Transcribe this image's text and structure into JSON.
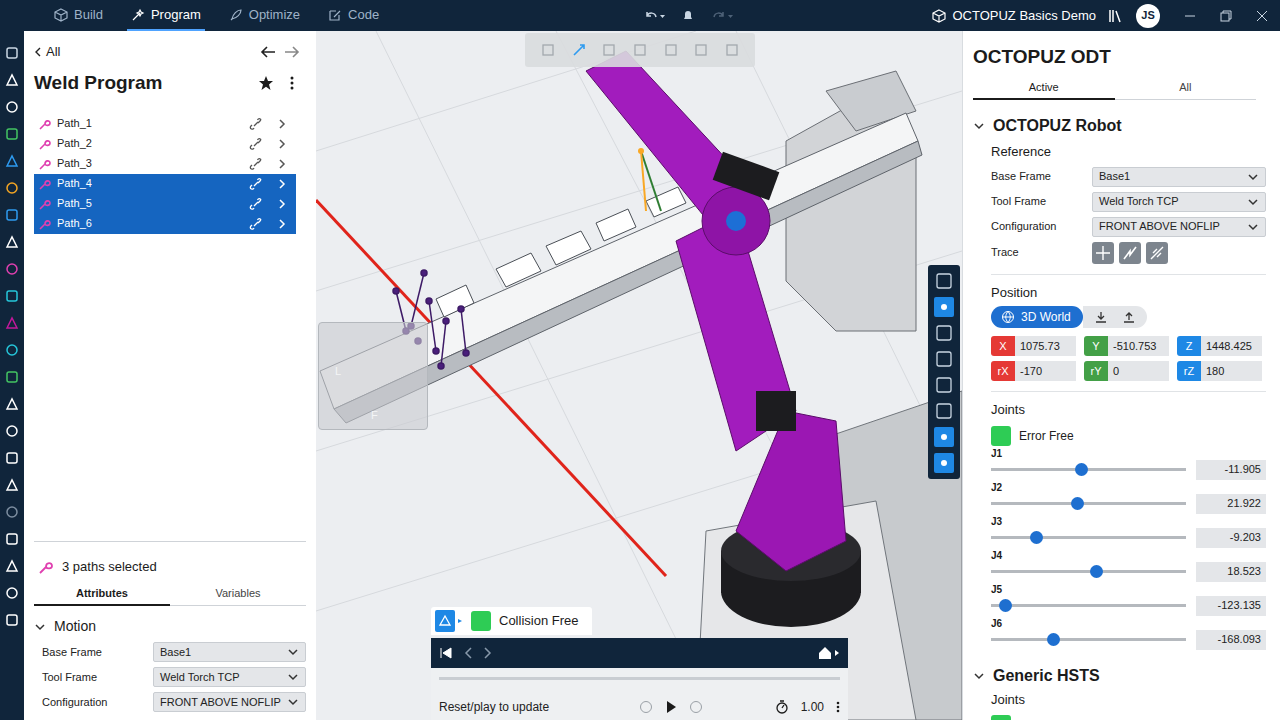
{
  "top_bar": {
    "tabs": [
      {
        "label": "Build",
        "selected": false
      },
      {
        "label": "Program",
        "selected": true
      },
      {
        "label": "Optimize",
        "selected": false
      },
      {
        "label": "Code",
        "selected": false
      }
    ],
    "redo_disabled": true,
    "project": "OCTOPUZ Basics Demo",
    "avatar": "JS"
  },
  "left_panel": {
    "back": "All",
    "title": "Weld Program",
    "paths": [
      {
        "name": "Path_1",
        "selected": false
      },
      {
        "name": "Path_2",
        "selected": false
      },
      {
        "name": "Path_3",
        "selected": false
      },
      {
        "name": "Path_4",
        "selected": true
      },
      {
        "name": "Path_5",
        "selected": true
      },
      {
        "name": "Path_6",
        "selected": true
      }
    ],
    "selection": "3 paths selected",
    "tabs": [
      {
        "label": "Attributes",
        "selected": true
      },
      {
        "label": "Variables",
        "selected": false
      }
    ],
    "motion": {
      "title": "Motion",
      "expanded": true,
      "fields": [
        {
          "label": "Base Frame",
          "value": "Base1"
        },
        {
          "label": "Tool Frame",
          "value": "Weld Torch TCP"
        },
        {
          "label": "Configuration",
          "value": "FRONT ABOVE NOFLIP"
        }
      ]
    }
  },
  "viewport": {
    "view_cube": [
      "L",
      "F"
    ],
    "collision": {
      "label": "Collision Free",
      "ok": true
    },
    "playback": {
      "hint": "Reset/play to update",
      "speed": "1.00"
    }
  },
  "right_panel": {
    "title": "OCTOPUZ ODT",
    "tabs": [
      {
        "label": "Active",
        "selected": true
      },
      {
        "label": "All",
        "selected": false
      }
    ],
    "robot": {
      "title": "OCTOPUZ Robot",
      "expanded": true,
      "reference": "Reference",
      "fields": [
        {
          "label": "Base Frame",
          "value": "Base1"
        },
        {
          "label": "Tool Frame",
          "value": "Weld Torch TCP"
        },
        {
          "label": "Configuration",
          "value": "FRONT ABOVE NOFLIP"
        }
      ],
      "trace": "Trace",
      "position": "Position",
      "frame": "3D World",
      "coords": [
        {
          "axis": "X",
          "value": "1075.73",
          "color": "#e53935"
        },
        {
          "axis": "Y",
          "value": "-510.753",
          "color": "#43a047"
        },
        {
          "axis": "Z",
          "value": "1448.425",
          "color": "#1e88e5"
        },
        {
          "axis": "rX",
          "value": "-170",
          "color": "#e53935"
        },
        {
          "axis": "rY",
          "value": "0",
          "color": "#43a047"
        },
        {
          "axis": "rZ",
          "value": "180",
          "color": "#1e88e5"
        }
      ],
      "joints_label": "Joints",
      "status": {
        "label": "Error Free",
        "ok": true
      },
      "joints": [
        {
          "name": "J1",
          "value": "-11.905",
          "level": 0.46
        },
        {
          "name": "J2",
          "value": "21.922",
          "level": 0.44
        },
        {
          "name": "J3",
          "value": "-9.203",
          "level": 0.23
        },
        {
          "name": "J4",
          "value": "18.523",
          "level": 0.54
        },
        {
          "name": "J5",
          "value": "-123.135",
          "level": 0.07
        },
        {
          "name": "J6",
          "value": "-168.093",
          "level": 0.32
        }
      ]
    },
    "hsts": {
      "title": "Generic HSTS",
      "expanded": true,
      "joints_label": "Joints",
      "status_ok": true
    }
  }
}
